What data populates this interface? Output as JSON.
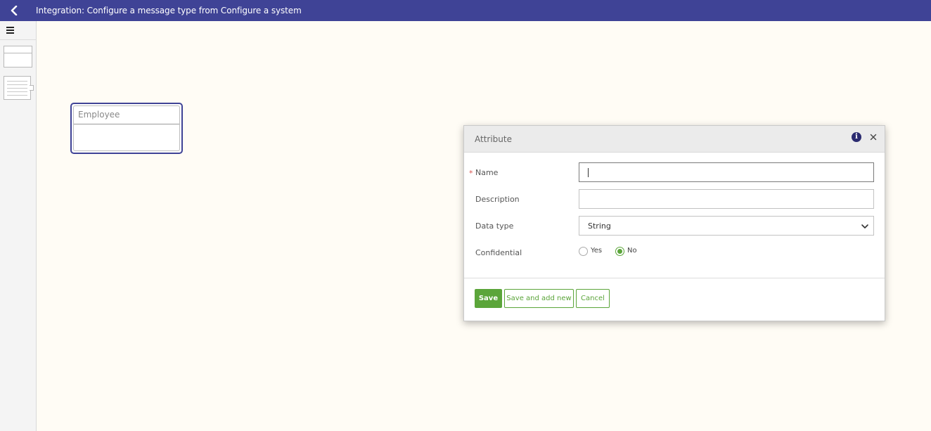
{
  "topbar": {
    "title": "Integration: Configure a message type from Configure a system",
    "back_icon": "chevron-left-icon"
  },
  "left_panel": {
    "menu_icon": "hamburger-menu-icon"
  },
  "canvas": {
    "entity": {
      "name": "Employee"
    }
  },
  "dialog": {
    "title": "Attribute",
    "info_icon": "info-icon",
    "close_icon": "close-icon",
    "fields": {
      "name": {
        "label": "Name",
        "required_mark": "*",
        "value": ""
      },
      "description": {
        "label": "Description",
        "value": ""
      },
      "data_type": {
        "label": "Data type",
        "value": "String"
      },
      "confidential": {
        "label": "Confidential",
        "options": [
          "Yes",
          "No"
        ],
        "selected": "No"
      }
    },
    "buttons": {
      "save": "Save",
      "save_and_add_new": "Save and add new",
      "cancel": "Cancel"
    }
  },
  "colors": {
    "topbar": "#3f4396",
    "accent_green": "#5ba53a",
    "canvas_bg": "#fffcf5"
  }
}
